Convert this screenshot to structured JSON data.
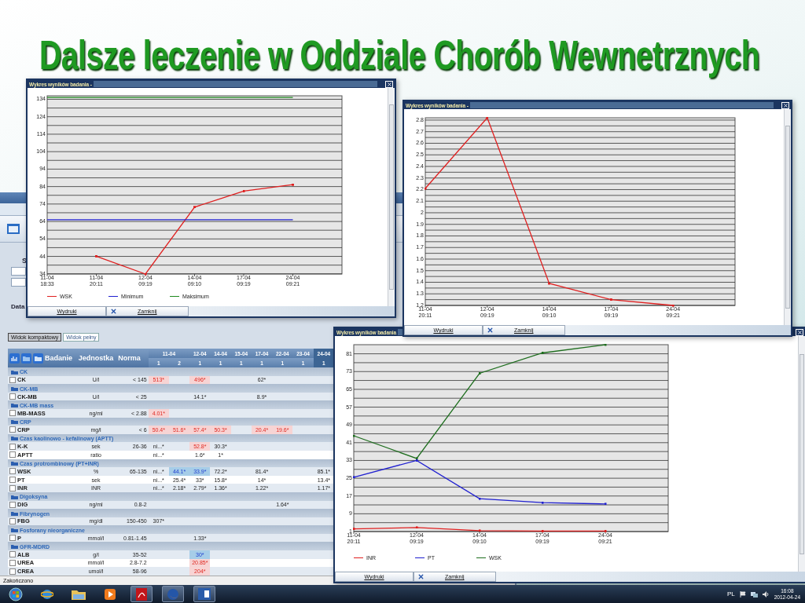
{
  "slide_title": "Dalsze leczenie w Oddziale Chorób Wewnetrznych",
  "browser": {
    "form_labels": [
      "S",
      "Data"
    ],
    "view_tabs": [
      {
        "label": "Widok kompaktowy",
        "selected": true
      },
      {
        "label": "Widok pełny",
        "selected": false
      }
    ],
    "columns": {
      "test": "Badanie",
      "unit": "Jednostka",
      "norm": "Norma"
    },
    "dates": [
      {
        "label": "11-04",
        "runs": [
          "1",
          "2"
        ],
        "selected": false
      },
      {
        "label": "12-04",
        "runs": [
          "1"
        ],
        "selected": false
      },
      {
        "label": "14-04",
        "runs": [
          "1"
        ],
        "selected": false
      },
      {
        "label": "15-04",
        "runs": [
          "1"
        ],
        "selected": false
      },
      {
        "label": "17-04",
        "runs": [
          "1"
        ],
        "selected": false
      },
      {
        "label": "22-04",
        "runs": [
          "1"
        ],
        "selected": false
      },
      {
        "label": "23-04",
        "runs": [
          "1"
        ],
        "selected": false
      },
      {
        "label": "24-04",
        "runs": [
          "1"
        ],
        "selected": true
      }
    ],
    "groups": [
      {
        "name": "CK",
        "rows": [
          {
            "test": "CK",
            "checked": false,
            "unit": "U/l",
            "norm": "< 145",
            "cells": [
              {
                "value": "513*",
                "high": true,
                "low": false
              },
              null,
              {
                "value": "496*",
                "high": true,
                "low": false
              },
              null,
              null,
              {
                "value": "62*",
                "high": false,
                "low": false
              },
              null,
              null,
              null
            ]
          }
        ]
      },
      {
        "name": "CK-MB",
        "rows": [
          {
            "test": "CK-MB",
            "checked": false,
            "unit": "U/l",
            "norm": "< 25",
            "cells": [
              null,
              null,
              {
                "value": "14.1*",
                "high": false,
                "low": false
              },
              null,
              null,
              {
                "value": "8.9*",
                "high": false,
                "low": false
              },
              null,
              null,
              null
            ]
          }
        ]
      },
      {
        "name": "CK-MB mass",
        "rows": [
          {
            "test": "MB-MASS",
            "checked": false,
            "unit": "ng/ml",
            "norm": "< 2.88",
            "cells": [
              {
                "value": "4.01*",
                "high": true,
                "low": false
              },
              null,
              null,
              null,
              null,
              null,
              null,
              null,
              null
            ]
          }
        ]
      },
      {
        "name": "CRP",
        "rows": [
          {
            "test": "CRP",
            "checked": false,
            "unit": "mg/l",
            "norm": "< 6",
            "cells": [
              {
                "value": "50.4*",
                "high": true,
                "low": false
              },
              {
                "value": "51.6*",
                "high": true,
                "low": false
              },
              {
                "value": "57.4*",
                "high": true,
                "low": false
              },
              {
                "value": "50.3*",
                "high": true,
                "low": false
              },
              null,
              {
                "value": "20.4*",
                "high": true,
                "low": false
              },
              {
                "value": "19.6*",
                "high": true,
                "low": false
              },
              null,
              null
            ]
          }
        ]
      },
      {
        "name": "Czas kaolinowo - kefalinowy (APTT)",
        "rows": [
          {
            "test": "K-K",
            "checked": false,
            "unit": "sek",
            "norm": "26-36",
            "cells": [
              {
                "value": "ni...*",
                "high": false,
                "low": false
              },
              null,
              {
                "value": "52.8*",
                "high": true,
                "low": false
              },
              {
                "value": "30.3*",
                "high": false,
                "low": false
              },
              null,
              null,
              null,
              null,
              null
            ]
          },
          {
            "test": "APTT",
            "checked": false,
            "unit": "ratio",
            "cells": [
              {
                "value": "ni...*",
                "high": false,
                "low": false
              },
              null,
              {
                "value": "1.6*",
                "high": false,
                "low": false
              },
              {
                "value": "1*",
                "high": false,
                "low": false
              },
              null,
              null,
              null,
              null,
              null
            ]
          }
        ]
      },
      {
        "name": "Czas protrombinowy (PT+INR)",
        "rows": [
          {
            "test": "WSK",
            "checked": false,
            "unit": "%",
            "norm": "65-135",
            "cells": [
              {
                "value": "ni...*",
                "high": false,
                "low": false
              },
              {
                "value": "44.1*",
                "high": false,
                "low": true
              },
              {
                "value": "33.9*",
                "high": false,
                "low": true
              },
              {
                "value": "72.2*",
                "high": false,
                "low": false
              },
              null,
              {
                "value": "81.4*",
                "high": false,
                "low": false
              },
              null,
              null,
              {
                "value": "85.1*",
                "high": false,
                "low": false
              }
            ]
          },
          {
            "test": "PT",
            "checked": false,
            "unit": "sek",
            "cells": [
              {
                "value": "ni...*",
                "high": false,
                "low": false
              },
              {
                "value": "25.4*",
                "high": false,
                "low": false
              },
              {
                "value": "33*",
                "high": false,
                "low": false
              },
              {
                "value": "15.8*",
                "high": false,
                "low": false
              },
              null,
              {
                "value": "14*",
                "high": false,
                "low": false
              },
              null,
              null,
              {
                "value": "13.4*",
                "high": false,
                "low": false
              }
            ]
          },
          {
            "test": "INR",
            "checked": false,
            "unit": "INR",
            "cells": [
              {
                "value": "ni...*",
                "high": false,
                "low": false
              },
              {
                "value": "2.18*",
                "high": false,
                "low": false
              },
              {
                "value": "2.79*",
                "high": false,
                "low": false
              },
              {
                "value": "1.36*",
                "high": false,
                "low": false
              },
              null,
              {
                "value": "1.22*",
                "high": false,
                "low": false
              },
              null,
              null,
              {
                "value": "1.17*",
                "high": false,
                "low": false
              }
            ]
          }
        ]
      },
      {
        "name": "Digoksyna",
        "rows": [
          {
            "test": "DIG",
            "checked": false,
            "unit": "ng/ml",
            "norm": "0.8-2",
            "cells": [
              null,
              null,
              null,
              null,
              null,
              null,
              {
                "value": "1.64*",
                "high": false,
                "low": false
              },
              null,
              null
            ]
          }
        ]
      },
      {
        "name": "Fibrynogen",
        "rows": [
          {
            "test": "FBG",
            "checked": false,
            "unit": "mg/dl",
            "norm": "150-450",
            "cells": [
              {
                "value": "307*",
                "high": false,
                "low": false
              },
              null,
              null,
              null,
              null,
              null,
              null,
              null,
              null
            ]
          }
        ]
      },
      {
        "name": "Fosforany nieorganiczne",
        "rows": [
          {
            "test": "P",
            "checked": false,
            "unit": "mmol/l",
            "norm": "0.81-1.45",
            "cells": [
              null,
              null,
              {
                "value": "1.33*",
                "high": false,
                "low": false
              },
              null,
              null,
              null,
              null,
              null,
              null
            ]
          }
        ]
      },
      {
        "name": "GFR-MDRD",
        "rows": [
          {
            "test": "ALB",
            "checked": false,
            "unit": "g/l",
            "norm": "35-52",
            "cells": [
              null,
              null,
              {
                "value": "30*",
                "high": false,
                "low": true
              },
              null,
              null,
              null,
              null,
              null,
              null
            ]
          },
          {
            "test": "UREA",
            "checked": false,
            "unit": "mmol/l",
            "norm": "2.8-7.2",
            "cells": [
              null,
              null,
              {
                "value": "20.85*",
                "high": true,
                "low": false
              },
              null,
              null,
              null,
              null,
              null,
              null
            ]
          },
          {
            "test": "CREA",
            "checked": false,
            "unit": "umol/l",
            "norm": "58-96",
            "cells": [
              null,
              null,
              {
                "value": "204*",
                "high": true,
                "low": false
              },
              null,
              null,
              null,
              null,
              null,
              null
            ]
          }
        ]
      }
    ],
    "status_bar": "Zakończono"
  },
  "charts": [
    {
      "title": "Wykres wyników badania -",
      "buttons": [
        "Wydruki",
        "Zamknij"
      ],
      "chart_data": {
        "type": "line",
        "grid": true,
        "legend": "bottom",
        "categories": [
          "11-04 18:33",
          "11-04 20:11",
          "12-04 09:19",
          "14-04 09:10",
          "17-04 09:19",
          "24-04 09:21"
        ],
        "ylim": [
          33.9,
          136
        ],
        "yticks": [
          34,
          44,
          54,
          64,
          74,
          84,
          94,
          104,
          114,
          124,
          134
        ],
        "series": [
          {
            "name": "WSK",
            "color": "#e02020",
            "values": [
              null,
              44.1,
              33.9,
              72.2,
              81.4,
              85.1
            ]
          },
          {
            "name": "Minimum",
            "color": "#2020d0",
            "values": [
              65,
              65,
              65,
              65,
              65,
              65
            ]
          },
          {
            "name": "Maksimum",
            "color": "#1e8a1e",
            "values": [
              135,
              135,
              135,
              135,
              135,
              135
            ]
          }
        ]
      }
    },
    {
      "title": "Wykres wyników badania -",
      "buttons": [
        "Wydruki",
        "Zamknij"
      ],
      "chart_data": {
        "type": "line",
        "grid": true,
        "categories": [
          "11-04 20:11",
          "12-04 09:19",
          "14-04 09:10",
          "17-04 09:19",
          "24-04 09:21"
        ],
        "ylim": [
          1.2,
          2.82
        ],
        "yticks": [
          1.2,
          1.3,
          1.4,
          1.5,
          1.6,
          1.7,
          1.8,
          1.9,
          2,
          2.1,
          2.2,
          2.3,
          2.4,
          2.5,
          2.6,
          2.7,
          2.8
        ],
        "series": [
          {
            "color": "#e02020",
            "values": [
              2.21,
              2.82,
              1.39,
              1.25,
              1.2
            ]
          }
        ]
      }
    },
    {
      "title": "Wykres wyników badania",
      "buttons": [
        "Wydruki",
        "Zamknij"
      ],
      "chart_data": {
        "type": "line",
        "grid": true,
        "legend": "bottom",
        "categories": [
          "11-04 20:11",
          "12-04 09:19",
          "14-04 09:10",
          "17-04 09:19",
          "24-04 09:21"
        ],
        "ylim": [
          1,
          85.1
        ],
        "yticks": [
          1,
          9,
          17,
          25,
          33,
          41,
          49,
          57,
          65,
          73,
          81
        ],
        "series": [
          {
            "name": "INR",
            "color": "#e02020",
            "values": [
              2.2,
              2.8,
              1.4,
              1.2,
              1.2
            ]
          },
          {
            "name": "PT",
            "color": "#2020d0",
            "values": [
              25.4,
              33,
              15.8,
              14,
              13.4
            ]
          },
          {
            "name": "WSK",
            "color": "#1e6e1e",
            "values": [
              44.1,
              33.9,
              72.2,
              81.4,
              85.1
            ]
          }
        ]
      }
    }
  ],
  "taskbar": {
    "language": "PL",
    "time": "16:08",
    "date": "2012-04-24"
  }
}
